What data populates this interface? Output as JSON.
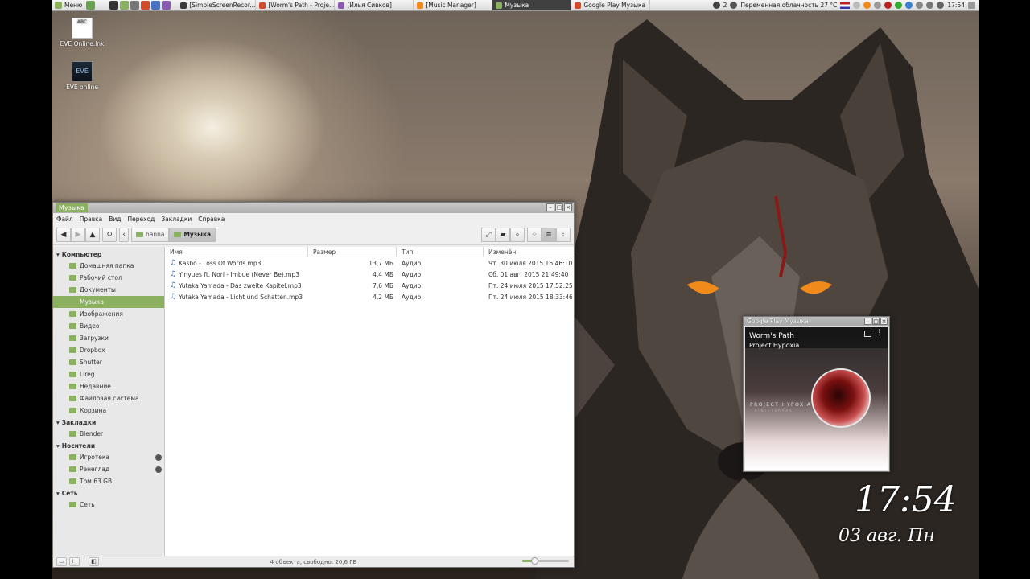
{
  "panel": {
    "menu_label": "Меню",
    "tasks": [
      {
        "label": "[SimpleScreenRecor...",
        "color": "#3a3a3a"
      },
      {
        "label": "[Worm's Path - Proje...",
        "color": "#d34a2a"
      },
      {
        "label": "[Илья Сивков]",
        "color": "#8a5ab0"
      },
      {
        "label": "[Music Manager]",
        "color": "#f08a1a"
      },
      {
        "label": "Музыка",
        "color": "#8bb160"
      },
      {
        "label": "Google Play Музыка",
        "color": "#d34a2a"
      }
    ],
    "tray_count": "2",
    "weather": "Переменная облачность 27 °C",
    "time": "17:54"
  },
  "desktop_icons": [
    {
      "label": "EVE Online.lnk",
      "icon": "document-icon"
    },
    {
      "label": "EVE online",
      "icon": "eve-icon"
    }
  ],
  "filemanager": {
    "title": "Музыка",
    "menu": [
      "Файл",
      "Правка",
      "Вид",
      "Переход",
      "Закладки",
      "Справка"
    ],
    "crumbs": [
      "hanna",
      "Музыка"
    ],
    "sidebar": [
      {
        "type": "header",
        "label": "Компьютер"
      },
      {
        "type": "item",
        "label": "Домашняя папка"
      },
      {
        "type": "item",
        "label": "Рабочий стол"
      },
      {
        "type": "item",
        "label": "Документы"
      },
      {
        "type": "item",
        "label": "Музыка",
        "selected": true
      },
      {
        "type": "item",
        "label": "Изображения"
      },
      {
        "type": "item",
        "label": "Видео"
      },
      {
        "type": "item",
        "label": "Загрузки"
      },
      {
        "type": "item",
        "label": "Dropbox"
      },
      {
        "type": "item",
        "label": "Shutter"
      },
      {
        "type": "item",
        "label": "Lireg"
      },
      {
        "type": "item",
        "label": "Недавние"
      },
      {
        "type": "item",
        "label": "Файловая система"
      },
      {
        "type": "item",
        "label": "Корзина"
      },
      {
        "type": "header",
        "label": "Закладки"
      },
      {
        "type": "item",
        "label": "Blender"
      },
      {
        "type": "header",
        "label": "Носители"
      },
      {
        "type": "item",
        "label": "Игротека",
        "eject": true
      },
      {
        "type": "item",
        "label": "Ренеглад",
        "eject": true
      },
      {
        "type": "item",
        "label": "Том 63 GB"
      },
      {
        "type": "header",
        "label": "Сеть"
      },
      {
        "type": "item",
        "label": "Сеть"
      }
    ],
    "columns": [
      "Имя",
      "Размер",
      "Тип",
      "Изменён"
    ],
    "files": [
      {
        "name": "Kasbo - Loss Of Words.mp3",
        "size": "13,7 МБ",
        "type": "Аудио",
        "modified": "Чт. 30 июля 2015 16:46:10"
      },
      {
        "name": "Yinyues ft. Nori - Imbue (Never Be).mp3",
        "size": "4,4 МБ",
        "type": "Аудио",
        "modified": "Сб. 01 авг. 2015 21:49:40"
      },
      {
        "name": "Yutaka Yamada - Das zweite Kapitel.mp3",
        "size": "7,6 МБ",
        "type": "Аудио",
        "modified": "Пт. 24 июля 2015 17:52:25"
      },
      {
        "name": "Yutaka Yamada - Licht und Schatten.mp3",
        "size": "4,2 МБ",
        "type": "Аудио",
        "modified": "Пт. 24 июля 2015 18:33:46"
      }
    ],
    "status": "4 объекта, свободно: 20,6 ГБ",
    "zoom_level": 0.25
  },
  "gpm": {
    "title": "Google Play Музыка",
    "track": "Worm's Path",
    "artist": "Project Hypoxia",
    "art_text": "PROJECT HYPOXIA",
    "art_sub": "FINISTERRAE"
  },
  "clock": {
    "time": "17:54",
    "date": "03 авг. Пн"
  },
  "colors": {
    "accent": "#8bb160"
  }
}
